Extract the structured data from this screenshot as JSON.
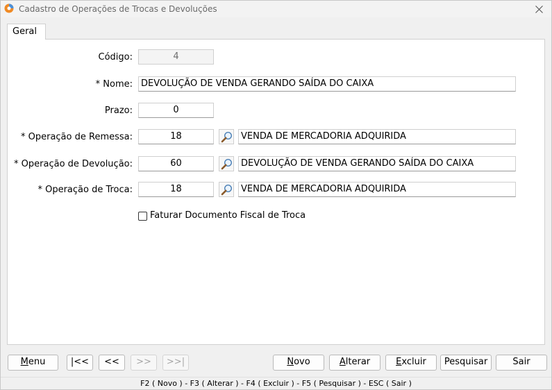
{
  "window": {
    "title": "Cadastro de Operações de Trocas e Devoluções"
  },
  "tabs": [
    {
      "label": "Geral"
    }
  ],
  "form": {
    "codigo": {
      "label": "Código:",
      "value": "4"
    },
    "nome": {
      "label": "* Nome:",
      "value": "DEVOLUÇÃO DE VENDA GERANDO SAÍDA DO CAIXA"
    },
    "prazo": {
      "label": "Prazo:",
      "value": "0"
    },
    "remessa": {
      "label": "* Operação de Remessa:",
      "code": "18",
      "description": "VENDA DE MERCADORIA ADQUIRIDA"
    },
    "devolucao": {
      "label": "* Operação de Devolução:",
      "code": "60",
      "description": "DEVOLUÇÃO DE VENDA GERANDO SAÍDA DO CAIXA"
    },
    "troca": {
      "label": "* Operação de Troca:",
      "code": "18",
      "description": "VENDA DE MERCADORIA ADQUIRIDA"
    },
    "faturar": {
      "label": "Faturar Documento Fiscal de Troca",
      "checked": false
    }
  },
  "buttons": {
    "menu": {
      "hotkey": "M",
      "rest": "enu"
    },
    "first": "|<<",
    "prev": "<<",
    "next": ">>",
    "last": ">>|",
    "novo": {
      "hotkey": "N",
      "rest": "ovo"
    },
    "alterar": {
      "hotkey": "A",
      "rest": "lterar"
    },
    "excluir": {
      "hotkey": "E",
      "rest": "xcluir"
    },
    "pesquisar": "Pesquisar",
    "sair": "Sair"
  },
  "status": {
    "shortcuts": "F2 ( Novo )  -  F3 ( Alterar )  -  F4 ( Excluir )  -  F5 ( Pesquisar )  -  ESC ( Sair )"
  },
  "colors": {
    "panel": "#ffffff",
    "window": "#f0f0f0",
    "icon_orange": "#f08a24",
    "icon_blue": "#4a8fd8"
  },
  "icons": {
    "app": "app-logo-icon",
    "close": "close-icon",
    "lookup": "magnifier-icon"
  }
}
